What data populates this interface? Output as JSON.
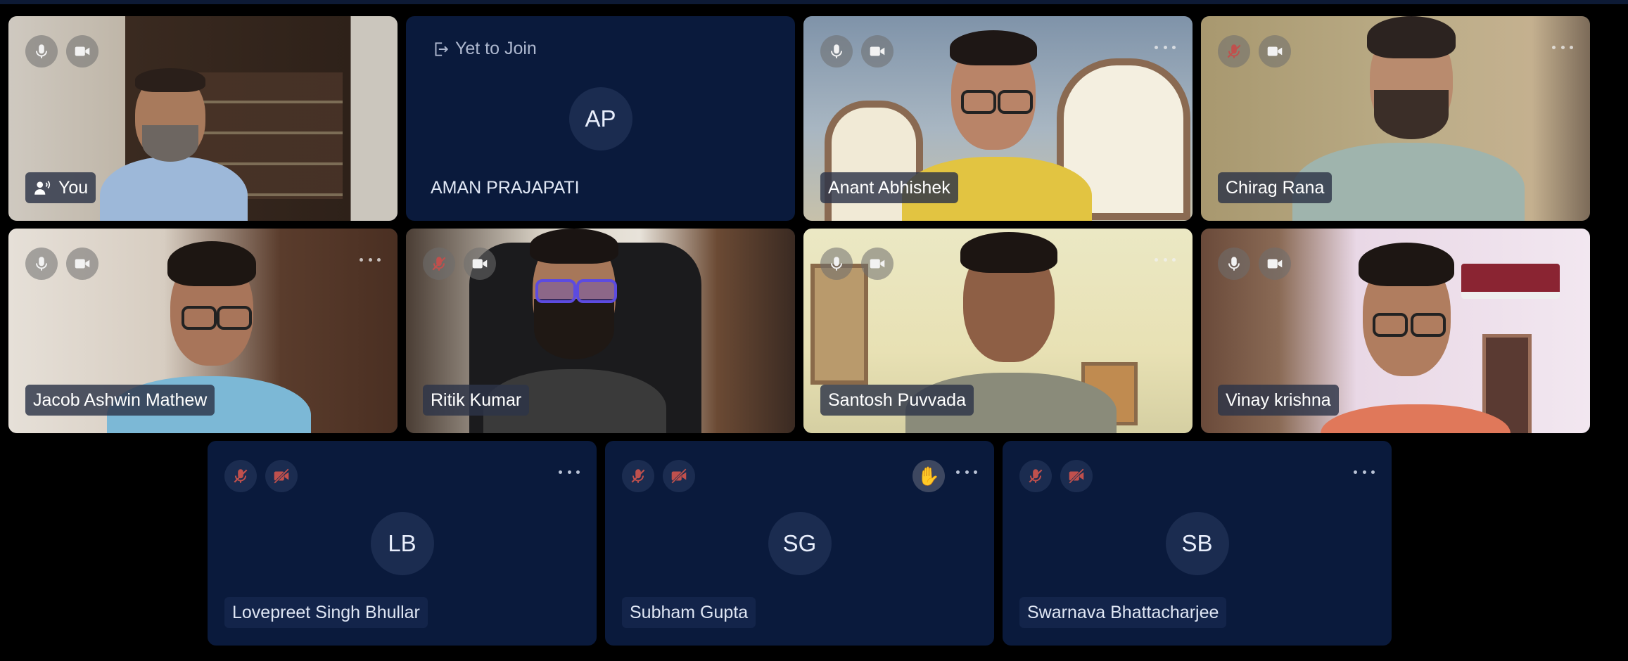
{
  "colors": {
    "page_background": "#000000",
    "tile_background": "#0a1a3c",
    "avatar_background": "#1b2c50",
    "muted_icon": "#c0504d"
  },
  "self_tile": {
    "name": "You"
  },
  "pending": {
    "status": "Yet to Join",
    "initials": "AP",
    "name": "AMAN PRAJAPATI"
  },
  "participants": [
    {
      "name": "Anant Abhishek"
    },
    {
      "name": "Chirag Rana"
    },
    {
      "name": "Jacob Ashwin Mathew"
    },
    {
      "name": "Ritik Kumar"
    },
    {
      "name": "Santosh Puvvada"
    },
    {
      "name": "Vinay krishna"
    }
  ],
  "audio_only": [
    {
      "initials": "LB",
      "name": "Lovepreet Singh Bhullar"
    },
    {
      "initials": "SG",
      "name": "Subham Gupta",
      "hand_raised": true
    },
    {
      "initials": "SB",
      "name": "Swarnava Bhattacharjee"
    }
  ],
  "icons": [
    "mic-icon",
    "mic-off-icon",
    "camera-icon",
    "camera-off-icon",
    "more-icon",
    "speaker-icon",
    "exit-icon",
    "raised-hand-icon"
  ]
}
